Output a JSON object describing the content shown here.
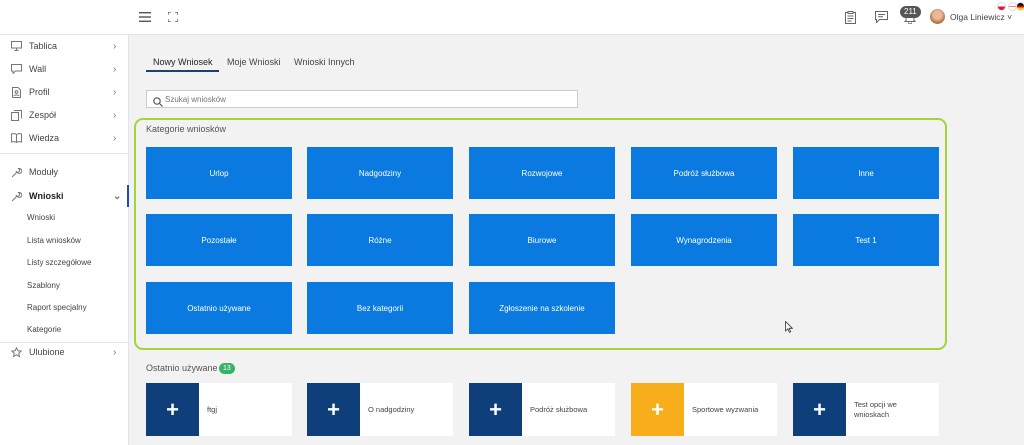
{
  "header": {
    "badge_count": "211",
    "user_name": "Olga Liniewicz ˅",
    "icons": [
      "menu-icon",
      "expand-icon",
      "clipboard-icon",
      "chat-icon",
      "bell-icon"
    ]
  },
  "sidebar": {
    "items": [
      {
        "label": "Tablica",
        "icon": "monitor-icon",
        "chevron": "›"
      },
      {
        "label": "Wall",
        "icon": "comment-icon",
        "chevron": "›"
      },
      {
        "label": "Profil",
        "icon": "profile-icon",
        "chevron": "›"
      },
      {
        "label": "Zespół",
        "icon": "team-icon",
        "chevron": "›"
      },
      {
        "label": "Wiedza",
        "icon": "book-icon",
        "chevron": "›"
      },
      {
        "label": "Moduły",
        "icon": "wrench-icon",
        "chevron": ""
      },
      {
        "label": "Wnioski",
        "icon": "wrench-icon",
        "chevron": "⌄"
      },
      {
        "label": "Ulubione",
        "icon": "star-icon",
        "chevron": "›"
      }
    ],
    "sub_items": [
      "Wnioski",
      "Lista wniosków",
      "Listy szczegółowe",
      "Szablony",
      "Raport specjalny",
      "Kategorie"
    ]
  },
  "tabs": [
    "Nowy Wniosek",
    "Moje Wnioski",
    "Wnioski Innych"
  ],
  "search": {
    "placeholder": "Szukaj wniosków"
  },
  "categories": {
    "title": "Kategorie wniosków",
    "tiles": [
      "Urlop",
      "Nadgodziny",
      "Rozwojowe",
      "Podróż służbowa",
      "Inne",
      "Pozostałe",
      "Różne",
      "Biurowe",
      "Wynagrodzenia",
      "Test 1",
      "Ostatnio używane",
      "Bez kategorii",
      "Zgłoszenie na szkolenie"
    ]
  },
  "recent": {
    "title": "Ostatnio używane",
    "count": "13",
    "plus_symbol": "+",
    "cards": [
      {
        "label": "ftgj",
        "color": "#0e3f7a"
      },
      {
        "label": "O nadgodziny",
        "color": "#0e3f7a"
      },
      {
        "label": "Podróż służbowa",
        "color": "#0e3f7a"
      },
      {
        "label": "Sportowe wyzwania",
        "color": "#f7ae1a"
      },
      {
        "label": "Test opcji we wnioskach",
        "color": "#0e3f7a"
      }
    ]
  },
  "colors": {
    "tile_blue": "#0a7ae0",
    "panel_border": "#a4d33a",
    "badge_green": "#36b36a",
    "active_tab": "#1f3e73"
  }
}
